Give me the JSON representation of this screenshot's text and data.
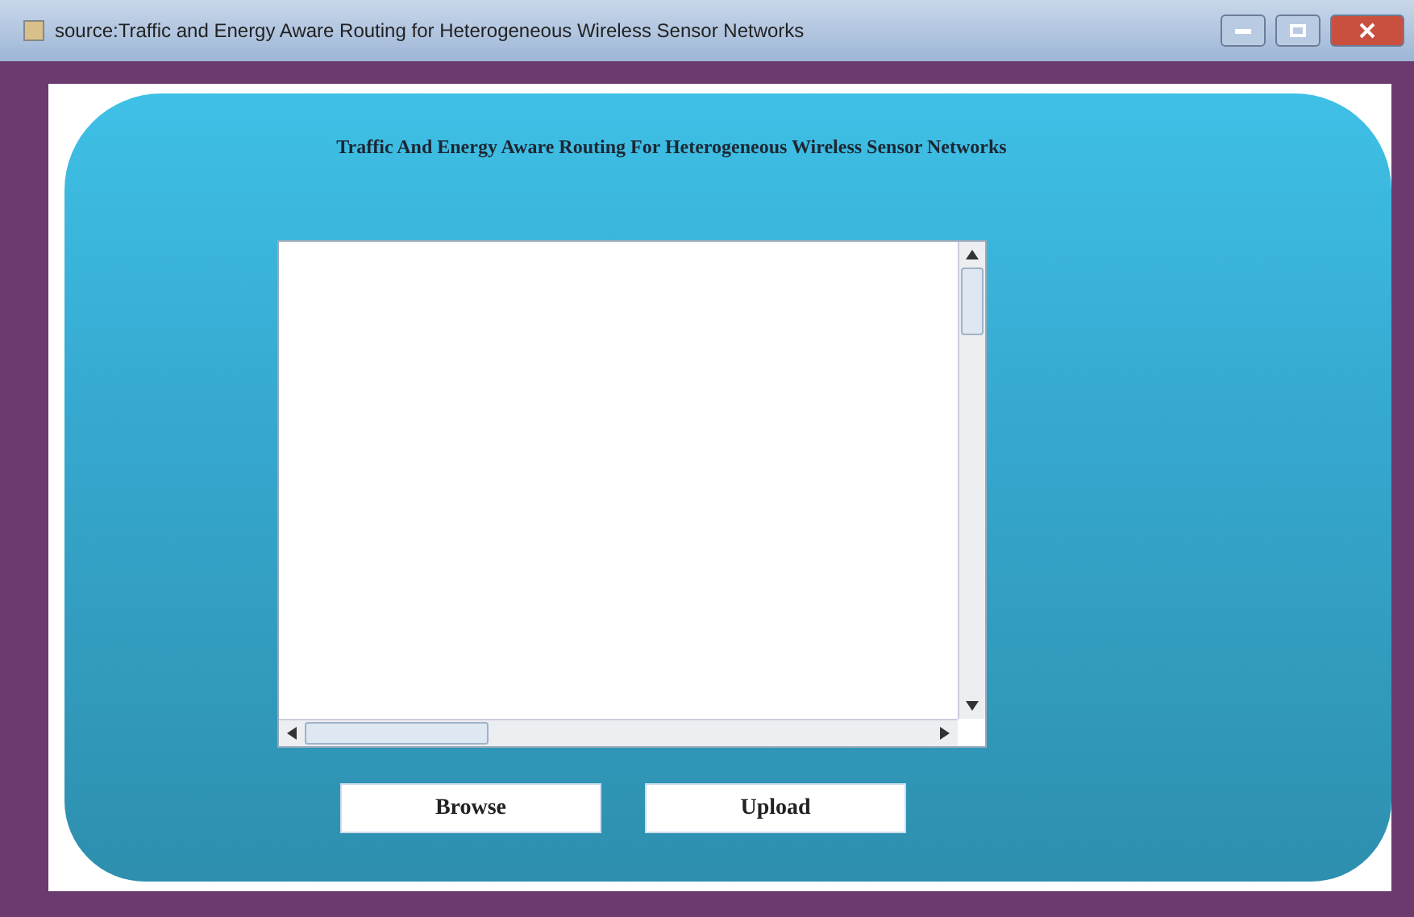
{
  "window": {
    "title": "source:Traffic and Energy Aware Routing for Heterogeneous Wireless Sensor Networks"
  },
  "heading": "Traffic And Energy Aware Routing For Heterogeneous Wireless Sensor Networks",
  "buttons": [
    "Browse",
    "Upload"
  ]
}
